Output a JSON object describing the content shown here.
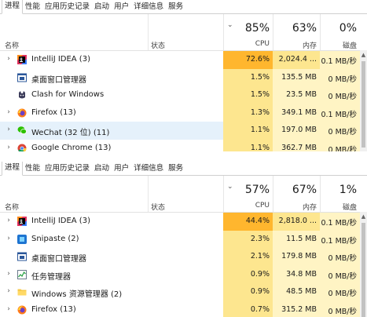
{
  "colors": {
    "heat_hi": "#ffb62e",
    "heat_mid": "#fde68f",
    "heat_low": "#fff4c4",
    "select": "#e5f1fb",
    "divider": "#cfcfcf"
  },
  "panels": [
    {
      "tabs": [
        "进程",
        "性能",
        "应用历史记录",
        "启动",
        "用户",
        "详细信息",
        "服务"
      ],
      "header": {
        "cpu_pct": "85%",
        "mem_pct": "63%",
        "disk_pct": "0%",
        "name": "名称",
        "status": "状态",
        "cpu": "CPU",
        "mem": "内存",
        "disk": "磁盘"
      },
      "rows": [
        {
          "expand": true,
          "icon": "intellij-idea-icon",
          "name": "IntelliJ IDEA (3)",
          "cpu": "72.6%",
          "mem": "2,024.4 ...",
          "disk": "0.1 MB/秒",
          "heat": [
            "hi",
            "mid",
            "low"
          ]
        },
        {
          "expand": false,
          "icon": "desktop-window-icon",
          "name": "桌面窗口管理器",
          "cpu": "1.5%",
          "mem": "135.5 MB",
          "disk": "0 MB/秒",
          "heat": [
            "mid",
            "low",
            "low"
          ]
        },
        {
          "expand": false,
          "icon": "clash-icon",
          "name": "Clash for Windows",
          "cpu": "1.5%",
          "mem": "23.5 MB",
          "disk": "0 MB/秒",
          "heat": [
            "mid",
            "low",
            "low"
          ]
        },
        {
          "expand": true,
          "icon": "firefox-icon",
          "name": "Firefox (13)",
          "cpu": "1.3%",
          "mem": "349.1 MB",
          "disk": "0.1 MB/秒",
          "heat": [
            "mid",
            "low",
            "low"
          ]
        },
        {
          "expand": true,
          "icon": "wechat-icon",
          "name": "WeChat (32 位) (11)",
          "cpu": "1.1%",
          "mem": "197.0 MB",
          "disk": "0 MB/秒",
          "heat": [
            "mid",
            "low",
            "low"
          ],
          "selected": true
        },
        {
          "expand": true,
          "icon": "chrome-icon",
          "name": "Google Chrome (13)",
          "cpu": "1.1%",
          "mem": "362.7 MB",
          "disk": "0 MB/秒",
          "heat": [
            "mid",
            "low",
            "low"
          ]
        }
      ]
    },
    {
      "tabs": [
        "进程",
        "性能",
        "应用历史记录",
        "启动",
        "用户",
        "详细信息",
        "服务"
      ],
      "header": {
        "cpu_pct": "57%",
        "mem_pct": "67%",
        "disk_pct": "1%",
        "name": "名称",
        "status": "状态",
        "cpu": "CPU",
        "mem": "内存",
        "disk": "磁盘"
      },
      "rows": [
        {
          "expand": true,
          "icon": "intellij-idea-icon",
          "name": "IntelliJ IDEA (3)",
          "cpu": "44.4%",
          "mem": "2,818.0 ...",
          "disk": "0.1 MB/秒",
          "heat": [
            "hi",
            "mid",
            "low"
          ]
        },
        {
          "expand": true,
          "icon": "snipaste-icon",
          "name": "Snipaste (2)",
          "cpu": "2.3%",
          "mem": "11.5 MB",
          "disk": "0.1 MB/秒",
          "heat": [
            "mid",
            "low",
            "low"
          ]
        },
        {
          "expand": false,
          "icon": "desktop-window-icon",
          "name": "桌面窗口管理器",
          "cpu": "2.1%",
          "mem": "179.8 MB",
          "disk": "0 MB/秒",
          "heat": [
            "mid",
            "low",
            "low"
          ]
        },
        {
          "expand": true,
          "icon": "task-manager-icon",
          "name": "任务管理器",
          "cpu": "0.9%",
          "mem": "34.8 MB",
          "disk": "0 MB/秒",
          "heat": [
            "mid",
            "low",
            "low"
          ]
        },
        {
          "expand": true,
          "icon": "explorer-folder-icon",
          "name": "Windows 资源管理器 (2)",
          "cpu": "0.9%",
          "mem": "48.5 MB",
          "disk": "0 MB/秒",
          "heat": [
            "mid",
            "low",
            "low"
          ]
        },
        {
          "expand": true,
          "icon": "firefox-icon",
          "name": "Firefox (13)",
          "cpu": "0.7%",
          "mem": "315.2 MB",
          "disk": "0 MB/秒",
          "heat": [
            "mid",
            "low",
            "low"
          ]
        }
      ]
    }
  ]
}
